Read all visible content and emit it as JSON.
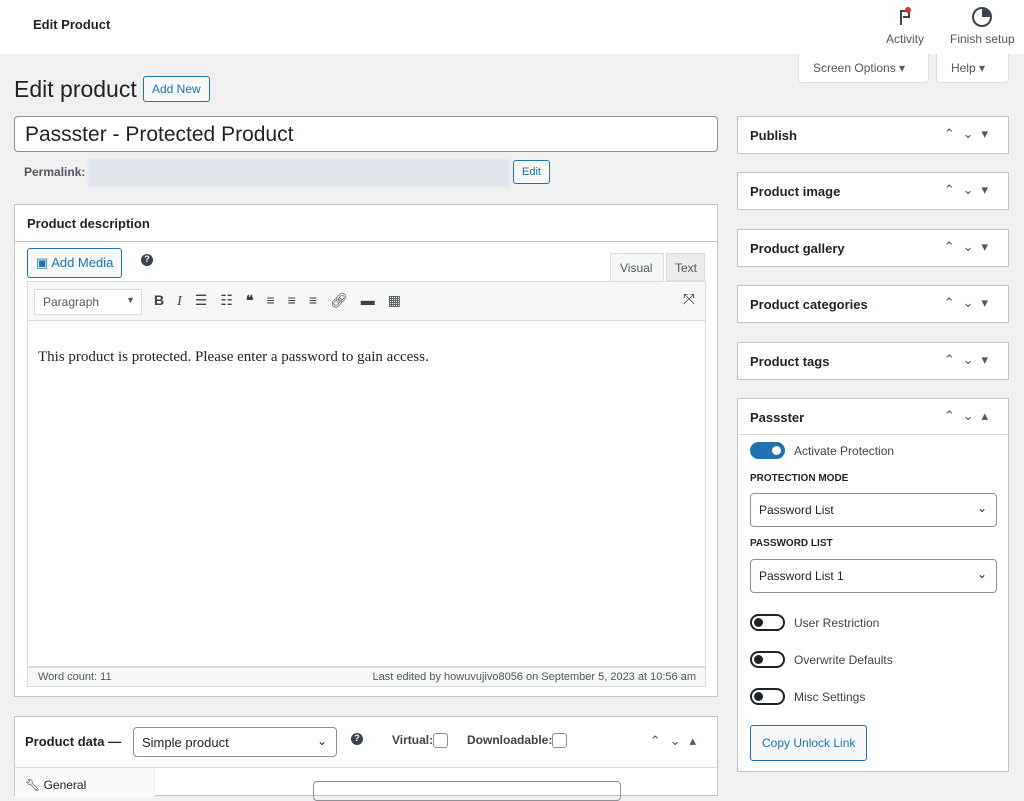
{
  "topbar": {
    "title": "Edit Product",
    "activity": "Activity",
    "finish_setup": "Finish setup"
  },
  "screen_options": "Screen Options ▾",
  "help": "Help ▾",
  "page": {
    "heading": "Edit product",
    "add_new": "Add New"
  },
  "post_title": "Passster - Protected Product",
  "permalink": {
    "label": "Permalink:",
    "edit": "Edit"
  },
  "description": {
    "title": "Product description",
    "add_media": "Add Media",
    "tab_visual": "Visual",
    "tab_text": "Text",
    "format_select": "Paragraph",
    "content": "This product is protected. Please enter a password to gain access.",
    "word_count": "Word count: 11",
    "last_edited": "Last edited by howuvujivo8056 on September 5, 2023 at 10:56 am"
  },
  "product_data": {
    "label": "Product data —",
    "type": "Simple product",
    "virtual": "Virtual:",
    "downloadable": "Downloadable:",
    "tab_general": "General"
  },
  "sidebar": {
    "boxes": [
      {
        "label": "Publish"
      },
      {
        "label": "Product image"
      },
      {
        "label": "Product gallery"
      },
      {
        "label": "Product categories"
      },
      {
        "label": "Product tags"
      }
    ]
  },
  "passster": {
    "title": "Passster",
    "activate": "Activate Protection",
    "activate_on": true,
    "mode_label": "PROTECTION MODE",
    "mode_value": "Password List",
    "list_label": "PASSWORD LIST",
    "list_value": "Password List 1",
    "user_restriction": "User Restriction",
    "overwrite_defaults": "Overwrite Defaults",
    "misc_settings": "Misc Settings",
    "copy_link": "Copy Unlock Link"
  },
  "colors": {
    "accent": "#2271b1",
    "background": "#f0f0f1"
  }
}
